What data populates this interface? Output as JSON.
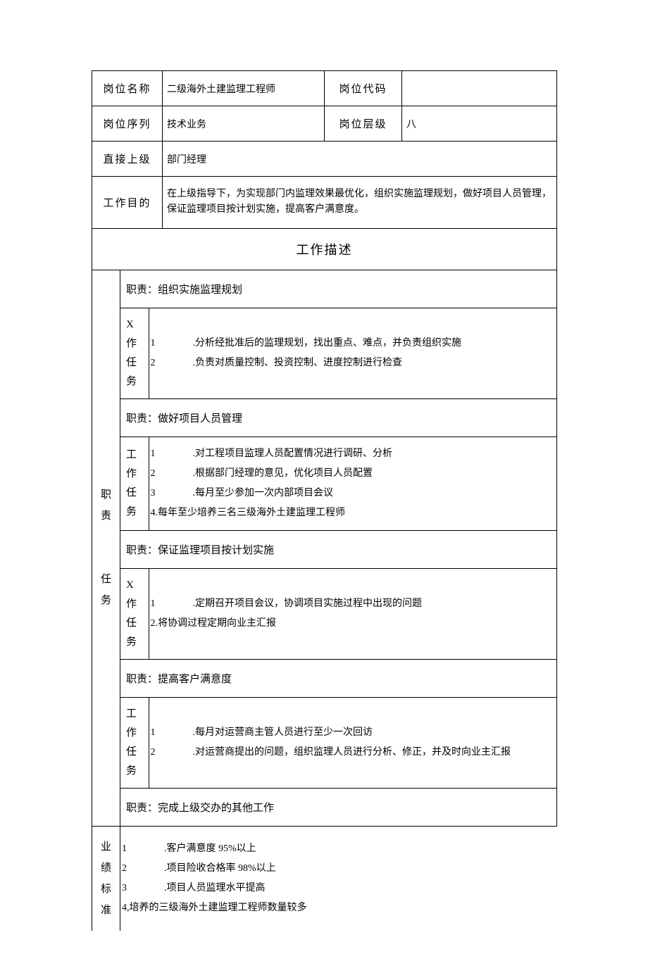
{
  "header": {
    "position_name_label": "岗位名称",
    "position_name_value": "二级海外土建监理工程师",
    "position_code_label": "岗位代码",
    "position_code_value": "",
    "position_series_label": "岗位序列",
    "position_series_value": "技术业务",
    "position_level_label": "岗位层级",
    "position_level_value": "八",
    "direct_superior_label": "直接上级",
    "direct_superior_value": "部门经理",
    "work_purpose_label": "工作目的",
    "work_purpose_value": "在上级指导下，为实现部门内监理效果最优化，组织实施监理规划，做好项目人员管理，保证监理项目按计划实施，提高客户满意度。"
  },
  "work_desc_title": "工作描述",
  "side_duty_label": "职责\n\n任务",
  "perf_side_label": "业绩标准",
  "duties": [
    {
      "title": "职责：组织实施监理规划",
      "task_label": "X作任务",
      "tasks_html": "<span class=\"num\">1</span>.分析经批准后的监理规划，找出重点、难点，并负责组织实施<br><span class=\"num\">2</span>.负责对质量控制、投资控制、进度控制进行检查"
    },
    {
      "title": "职责：做好项目人员管理",
      "task_label": "工作任务",
      "tasks_html": "<span class=\"num\">1</span>.对工程项目监理人员配置情况进行调研、分析<br><span class=\"num\">2</span>.根据部门经理的意见，优化项目人员配置<br><span class=\"num\">3</span>.每月至少参加一次内部项目会议<br>4.每年至少培养三名三级海外土建监理工程师"
    },
    {
      "title": "职责：保证监理项目按计划实施",
      "task_label": "X作任务",
      "tasks_html": "<span class=\"num\">1</span>.定期召开项目会议，协调项目实施过程中出现的问题<br>2.将协调过程定期向业主汇报"
    },
    {
      "title": "职责：提高客户满意度",
      "task_label": "工作任务",
      "tasks_html": "<span class=\"num\">1</span>.每月对运营商主管人员进行至少一次回访<br><span class=\"num\">2</span>.对运营商提出的问题，组织监理人员进行分析、修正，并及时向业主汇报"
    },
    {
      "title": "职责：完成上级交办的其他工作",
      "task_label": "",
      "tasks_html": ""
    }
  ],
  "performance_html": "<span class=\"num\">1</span>.客户满意度 95%以上<br><span class=\"num\">2</span>.项目险收合格率 98%以上<br><span class=\"num\">3</span>.项目人员监理水平提高<br>4,培养的三级海外土建监理工程师数量较多"
}
